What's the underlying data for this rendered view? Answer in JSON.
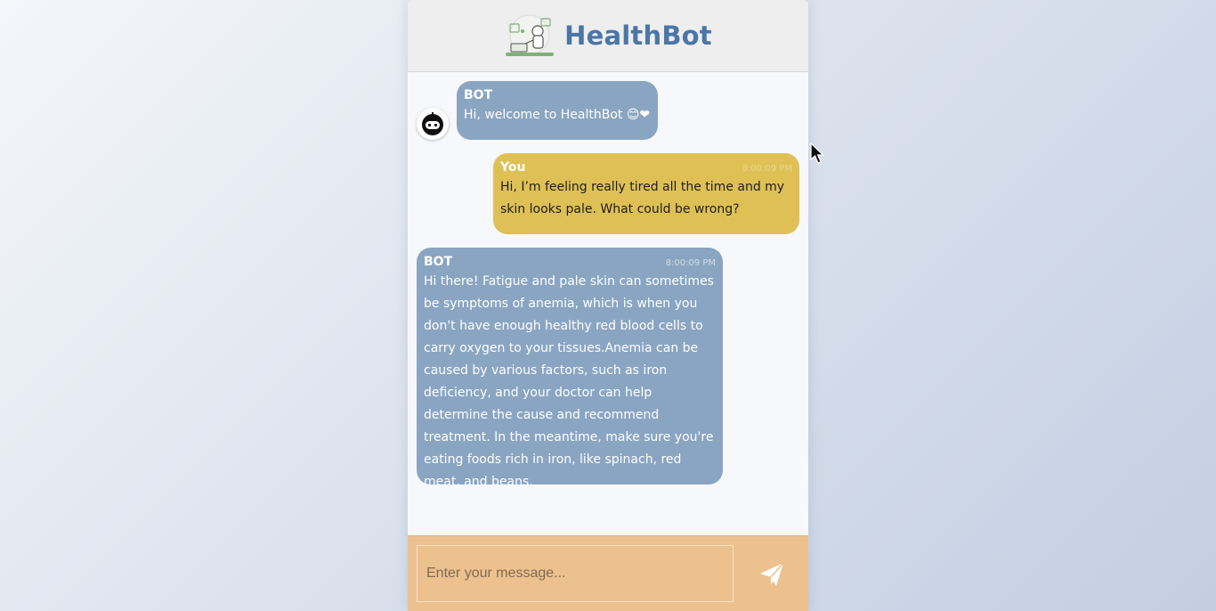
{
  "app": {
    "title": "HealthBot"
  },
  "messages": [
    {
      "sender": "BOT",
      "time": "",
      "text": "Hi, welcome to HealthBot 😊❤"
    },
    {
      "sender": "You",
      "time": "8:00:09 PM",
      "text": "Hi, I’m feeling really tired all the time and my skin looks pale. What could be wrong?"
    },
    {
      "sender": "BOT",
      "time": "8:00:09 PM",
      "text": "Hi there! Fatigue and pale skin can sometimes be symptoms of anemia, which is when you don't have enough healthy red blood cells to carry oxygen to your tissues.Anemia can be caused by various factors, such as iron deficiency, and your doctor can help determine the cause and recommend treatment. In the meantime, make sure you're eating foods rich in iron, like spinach, red meat, and beans."
    }
  ],
  "composer": {
    "placeholder": "Enter your message...",
    "value": ""
  },
  "icons": {
    "logo": "doctor-robot-logo-icon",
    "avatar": "bot-avatar-icon",
    "send": "paper-plane-send-icon",
    "cursor": "mouse-pointer-icon"
  },
  "colors": {
    "title": "#4a76a8",
    "bot_bubble": "#89a5c2",
    "user_bubble": "#dfc055",
    "footer": "#ecc18e"
  }
}
